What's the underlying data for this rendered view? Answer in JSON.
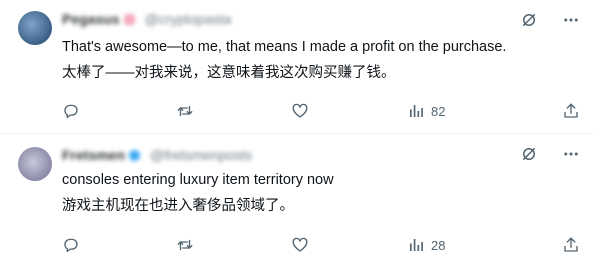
{
  "replies": [
    {
      "author": "Pegasus",
      "handle": "@cryptopasta",
      "text_en": "That's awesome—to me, that means I made a profit on the purchase.",
      "text_zh": "太棒了——对我来说，这意味着我这次购买赚了钱。",
      "views": "82"
    },
    {
      "author": "Fretsmen",
      "handle": "@fretsmenposts",
      "text_en": "consoles entering luxury item territory now",
      "text_zh": "游戏主机现在也进入奢侈品领域了。",
      "views": "28"
    }
  ],
  "icons": {
    "grok": "grok-icon",
    "more": "more-icon",
    "reply": "reply-icon",
    "retweet": "retweet-icon",
    "like": "like-icon",
    "views": "views-icon",
    "share": "share-icon"
  },
  "colors": {
    "text": "#0f1419",
    "muted": "#536471",
    "divider": "#eff3f4",
    "verified": "#1d9bf0"
  }
}
